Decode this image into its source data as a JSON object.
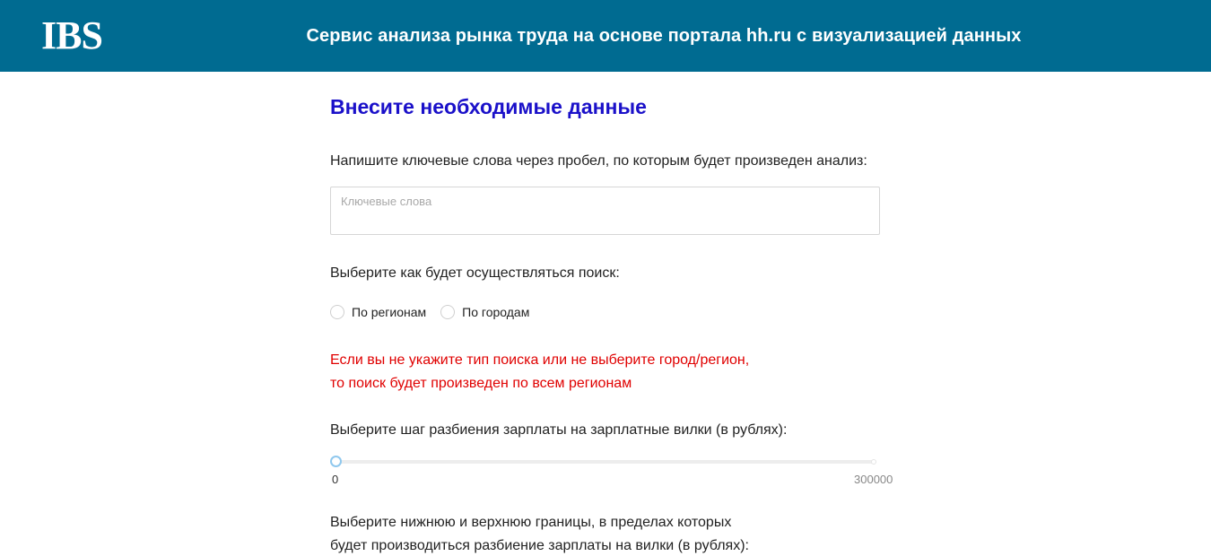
{
  "header": {
    "logo_text": "IBS",
    "title": "Сервис анализа рынка труда на основе портала hh.ru с визуализацией данных"
  },
  "form": {
    "title": "Внесите необходимые данные",
    "keywords_label": "Напишите ключевые слова через пробел, по которым будет произведен анализ:",
    "keywords_input": {
      "value": "",
      "placeholder": "Ключевые слова"
    },
    "search_type_label": "Выберите как будет осуществляться поиск:",
    "search_type_options": [
      "По регионам",
      "По городам"
    ],
    "warning_lines": [
      "Если вы не укажите тип поиска или не выберите город/регион,",
      "то поиск будет произведен по всем регионам"
    ],
    "salary_step_label": "Выберите шаг разбиения зарплаты на зарплатные вилки (в рублях):",
    "salary_step_slider": {
      "value": 0,
      "min": "0",
      "max": "300000"
    },
    "salary_bounds_label_lines": [
      "Выберите нижнюю и верхнюю границы, в пределах которых",
      "будет производиться разбиение зарплаты на вилки (в рублях):"
    ]
  },
  "colors": {
    "header_bg": "#006b91",
    "title_blue": "#1a10c9",
    "warning_red": "#e00000",
    "slider_handle": "#8fc8ee"
  }
}
